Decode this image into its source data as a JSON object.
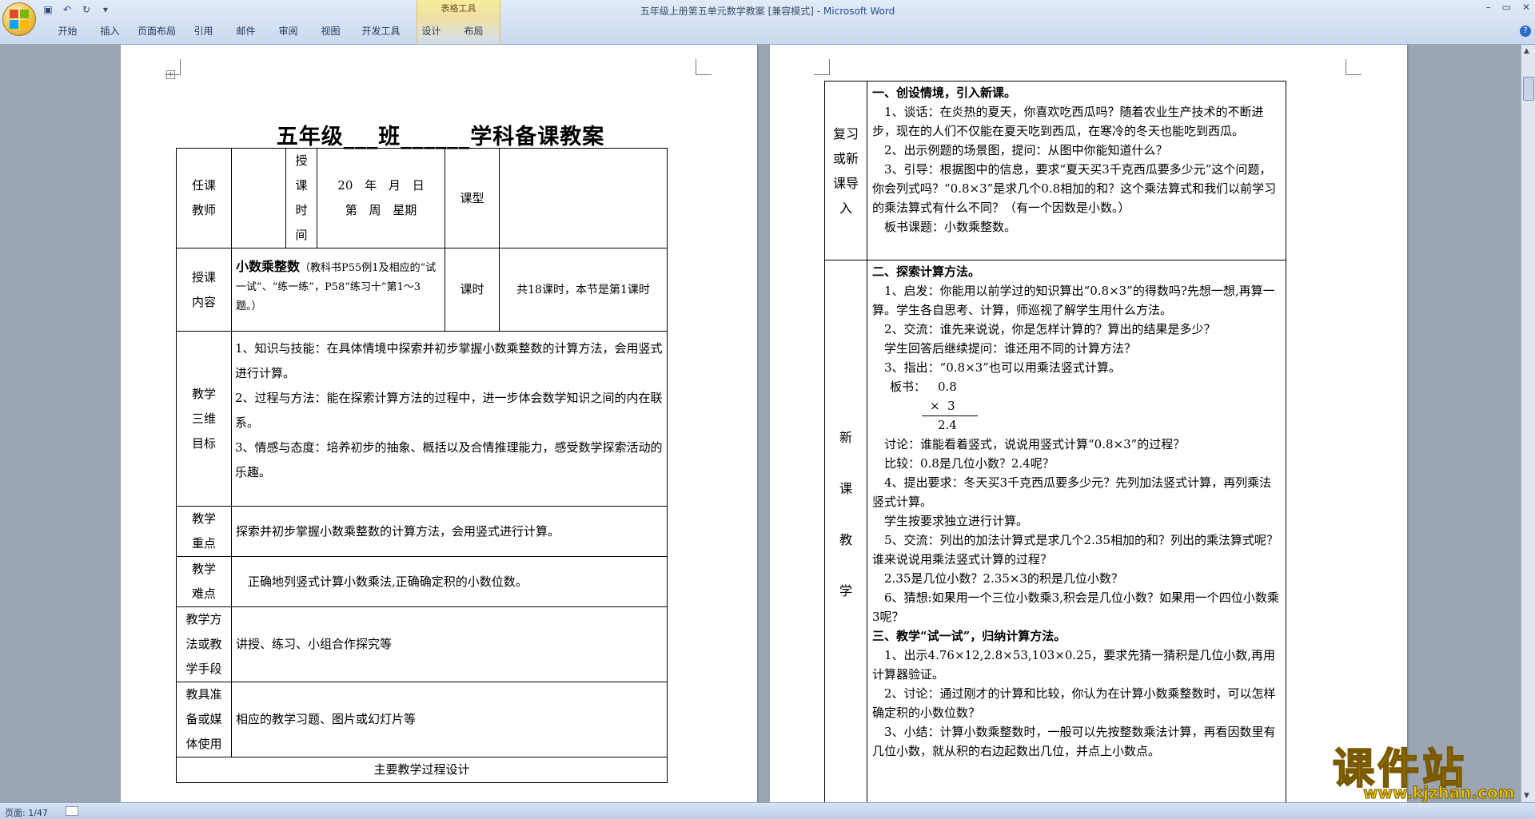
{
  "window": {
    "title_doc": "五年级上册第五单元数学教案 [兼容模式] - ",
    "title_app": "Microsoft Word",
    "context_tab_group": "表格工具",
    "controls": [
      "–",
      "▭",
      "✕"
    ]
  },
  "ribbon": {
    "tabs": [
      "开始",
      "插入",
      "页面布局",
      "引用",
      "邮件",
      "审阅",
      "视图",
      "开发工具",
      "设计",
      "布局"
    ]
  },
  "status": {
    "page": "页面: 1/47"
  },
  "icons": {
    "office": "office-logo-icon",
    "save": "save-icon",
    "undo": "undo-icon",
    "redo": "redo-icon",
    "help": "help-icon"
  },
  "doc": {
    "title": "五年级___班______学科备课教案",
    "teacher_label": "任课教师",
    "time_label": "授课时间",
    "date_line1": "20 年 月 日",
    "date_line2": "第 周 星期",
    "type_label": "课型",
    "content_label": "授课内容",
    "content_bold": "小数乘整数",
    "content_rest": "（教科书P55例1及相应的“试一试”、“练一练”，P58“练习十”第1～3题。）",
    "hours_label": "课时",
    "hours_value": "共18课时，本节是第1课时",
    "goals_label": "教学三维目标",
    "goal1": "1、知识与技能：在具体情境中探索并初步掌握小数乘整数的计算方法，会用竖式进行计算。",
    "goal2": "2、过程与方法：能在探索计算方法的过程中，进一步体会数学知识之间的内在联系。",
    "goal3": "3、情感与态度：培养初步的抽象、概括以及合情推理能力，感受数学探索活动的乐趣。",
    "key_label": "教学重点",
    "key_value": "探索并初步掌握小数乘整数的计算方法，会用竖式进行计算。",
    "diff_label": "教学难点",
    "diff_value": "正确地列竖式计算小数乘法,正确确定积的小数位数。",
    "method_label": "教学方法或教学手段",
    "method_value": "讲授、练习、小组合作探究等",
    "media_label": "教具准备或媒体使用",
    "media_value": "相应的教学习题、图片或幻灯片等",
    "process_label": "主要教学过程设计"
  },
  "page2": {
    "label_review": "复习或新课导入",
    "label_new": "新课教学",
    "s1_title": "一、创设情境，引入新课。",
    "s1_p1": "1、谈话：在炎热的夏天，你喜欢吃西瓜吗？随着农业生产技术的不断进步，现在的人们不仅能在夏天吃到西瓜，在寒冷的冬天也能吃到西瓜。",
    "s1_p2": "2、出示例题的场景图，提问：从图中你能知道什么？",
    "s1_p3": "3、引导：根据图中的信息，要求“夏天买3千克西瓜要多少元”这个问题，你会列式吗？“0.8×3”是求几个0.8相加的和？这个乘法算式和我们以前学习的乘法算式有什么不同？（有一个因数是小数。）",
    "s1_p4": "板书课题：小数乘整数。",
    "s2_title": "二、探索计算方法。",
    "s2_p1": "1、启发：你能用以前学过的知识算出“0.8×3”的得数吗?先想一想,再算一算。学生各自思考、计算，师巡视了解学生用什么方法。",
    "s2_p2": "2、交流：谁先来说说，你是怎样计算的？算出的结果是多少？",
    "s2_p3": "学生回答后继续提问：谁还用不同的计算方法？",
    "s2_p4": "3、指出：“0.8×3”也可以用乘法竖式计算。",
    "s2_board": "板书：",
    "s2_calc1": "0.8",
    "s2_calc2": "×  3",
    "s2_calc3": "2.4",
    "s2_p5": "讨论：谁能看着竖式，说说用竖式计算“0.8×3”的过程？",
    "s2_p6": "比较：0.8是几位小数？2.4呢？",
    "s2_p7": "4、提出要求：冬天买3千克西瓜要多少元？先列加法竖式计算，再列乘法竖式计算。",
    "s2_p8": "学生按要求独立进行计算。",
    "s2_p9": "5、交流：列出的加法计算式是求几个2.35相加的和？列出的乘法算式呢？谁来说说用乘法竖式计算的过程？",
    "s2_p10": "2.35是几位小数？2.35×3的积是几位小数？",
    "s2_p11": "6、猜想:如果用一个三位小数乘3,积会是几位小数？如果用一个四位小数乘3呢？",
    "s3_title": "三、教学“试一试”，归纳计算方法。",
    "s3_p1": "1、出示4.76×12,2.8×53,103×0.25，要求先猜一猜积是几位小数,再用计算器验证。",
    "s3_p2": "2、讨论：通过刚才的计算和比较，你认为在计算小数乘整数时，可以怎样确定积的小数位数？",
    "s3_p3": "3、小结：计算小数乘整数时，一般可以先按整数乘法计算，再看因数里有几位小数，就从积的右边起数出几位，并点上小数点。"
  },
  "watermark": {
    "big": "课件站",
    "small": "www.kjzhan.com"
  }
}
